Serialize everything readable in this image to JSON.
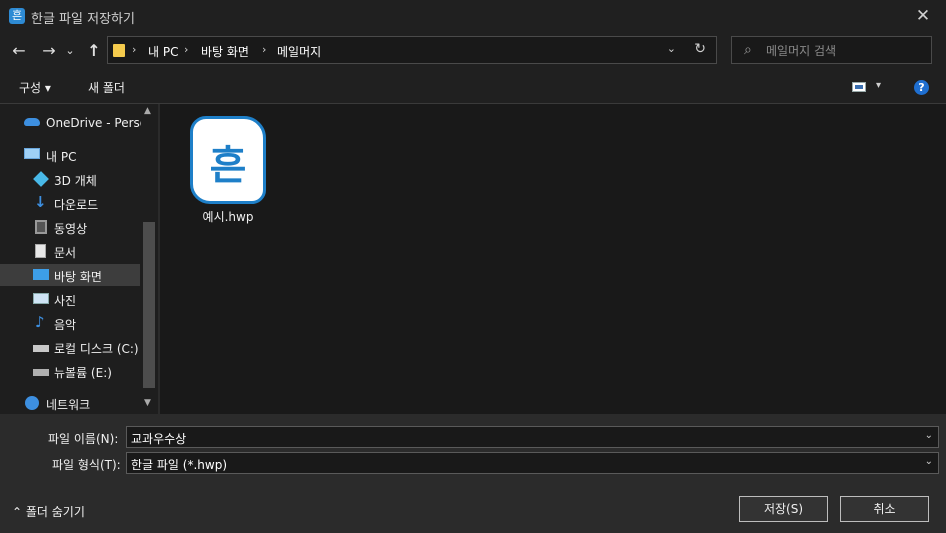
{
  "window": {
    "title": "한글 파일 저장하기",
    "app_icon_glyph": "흔",
    "close_glyph": "✕"
  },
  "nav": {
    "back_glyph": "←",
    "forward_glyph": "→",
    "history_glyph": "⌄",
    "up_glyph": "↑",
    "breadcrumbs": [
      "내 PC",
      "바탕 화면",
      "메일머지"
    ],
    "breadcrumb_sep": "›",
    "address_dropdown_glyph": "⌄",
    "refresh_glyph": "↻",
    "search_icon_glyph": "⌕",
    "search_placeholder": "메일머지 검색"
  },
  "toolbar": {
    "organize": "구성 ▾",
    "new_folder": "새 폴더",
    "view_dd": "▾",
    "help": "?"
  },
  "sidebar": {
    "items": [
      {
        "label": "OneDrive - Personal",
        "icon": "onedrive-cloud-icon"
      },
      {
        "label": "내 PC",
        "icon": "pc-icon"
      },
      {
        "label": "3D 개체",
        "icon": "3d-objects-icon"
      },
      {
        "label": "다운로드",
        "icon": "download-icon"
      },
      {
        "label": "동영상",
        "icon": "video-icon"
      },
      {
        "label": "문서",
        "icon": "document-icon"
      },
      {
        "label": "바탕 화면",
        "icon": "desktop-icon",
        "selected": true
      },
      {
        "label": "사진",
        "icon": "pictures-icon"
      },
      {
        "label": "음악",
        "icon": "music-icon"
      },
      {
        "label": "로컬 디스크 (C:)",
        "icon": "local-disk-icon"
      },
      {
        "label": "뉴볼륨 (E:)",
        "icon": "drive-icon"
      },
      {
        "label": "네트워크",
        "icon": "network-icon"
      }
    ],
    "scroll_up_glyph": "▲",
    "scroll_down_glyph": "▼"
  },
  "files": [
    {
      "name": "예시.hwp",
      "thumb_glyph": "흔",
      "icon": "hwp-file-icon"
    }
  ],
  "form": {
    "filename_label": "파일 이름(N):",
    "filename_value": "교과우수상",
    "filetype_label": "파일 형식(T):",
    "filetype_value": "한글 파일 (*.hwp)",
    "dropdown_glyph": "⌄",
    "hide_folders": "⌃  폴더 숨기기",
    "save_button": "저장(S)",
    "cancel_button": "취소"
  },
  "colors": {
    "accent": "#1e7fc8",
    "folder": "#f5cb4d",
    "help": "#1f6fd1"
  }
}
